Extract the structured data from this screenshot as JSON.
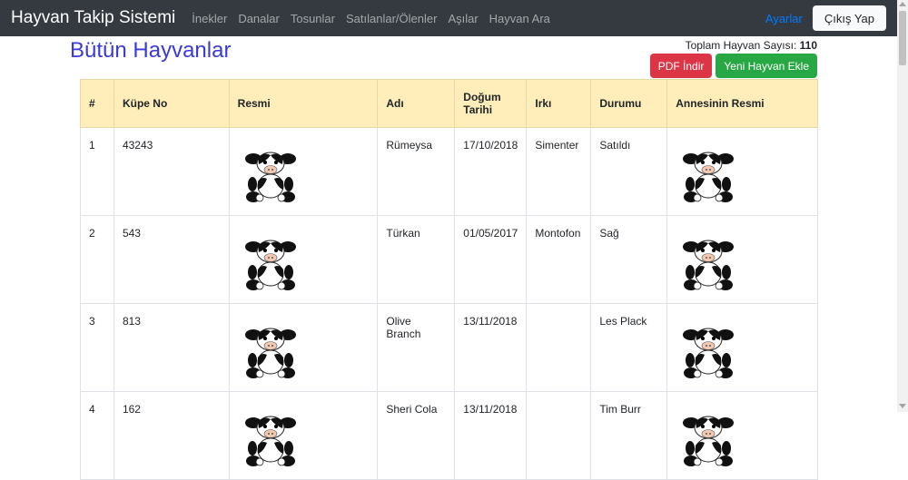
{
  "navbar": {
    "brand": "Hayvan Takip Sistemi",
    "links": [
      "İnekler",
      "Danalar",
      "Tosunlar",
      "Satılanlar/Ölenler",
      "Aşılar",
      "Hayvan Ara"
    ],
    "settings": "Ayarlar",
    "logout": "Çıkış Yap"
  },
  "page": {
    "title": "Bütün Hayvanlar",
    "total_label": "Toplam Hayvan Sayısı:",
    "total_value": "110",
    "pdf_button": "PDF İndir",
    "add_button": "Yeni Hayvan Ekle"
  },
  "table": {
    "headers": [
      "#",
      "Küpe No",
      "Resmi",
      "Adı",
      "Doğum Tarihi",
      "Irkı",
      "Durumu",
      "Annesinin Resmi"
    ],
    "rows": [
      {
        "num": "1",
        "tag": "43243",
        "name": "Rümeysa",
        "birth": "17/10/2018",
        "breed": "Simenter",
        "status": "Satıldı"
      },
      {
        "num": "2",
        "tag": "543",
        "name": "Türkan",
        "birth": "01/05/2017",
        "breed": "Montofon",
        "status": "Sağ"
      },
      {
        "num": "3",
        "tag": "813",
        "name": "Olive Branch",
        "birth": "13/11/2018",
        "breed": "",
        "status": "Les Plack"
      },
      {
        "num": "4",
        "tag": "162",
        "name": "Sheri Cola",
        "birth": "13/11/2018",
        "breed": "",
        "status": "Tim Burr"
      }
    ]
  },
  "colors": {
    "navbar": "#343a40",
    "title": "#3a3ad6",
    "header_row": "#ffeeba",
    "pdf_button": "#dc3545",
    "add_button": "#28a745",
    "settings_link": "#007bff"
  },
  "icons": [
    "cow-image-icon"
  ]
}
